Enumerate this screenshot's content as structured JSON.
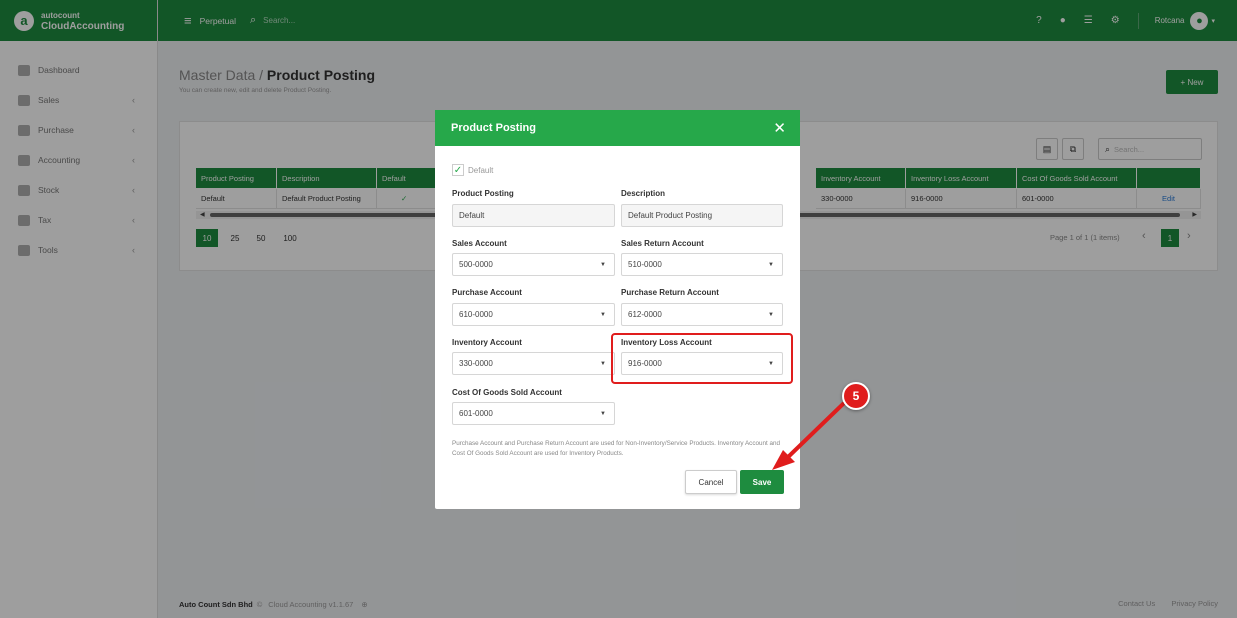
{
  "brand": {
    "logo_letter": "a",
    "top": "autocount",
    "bottom": "CloudAccounting"
  },
  "topbar": {
    "mode": "Perpetual",
    "search_placeholder": "Search...",
    "user": "Rotcana"
  },
  "sidebar": {
    "items": [
      {
        "label": "Dashboard",
        "icon": "dashboard-icon",
        "has_chevron": false
      },
      {
        "label": "Sales",
        "icon": "sales-icon",
        "has_chevron": true
      },
      {
        "label": "Purchase",
        "icon": "purchase-icon",
        "has_chevron": true
      },
      {
        "label": "Accounting",
        "icon": "accounting-icon",
        "has_chevron": true
      },
      {
        "label": "Stock",
        "icon": "stock-icon",
        "has_chevron": true
      },
      {
        "label": "Tax",
        "icon": "tax-icon",
        "has_chevron": true
      },
      {
        "label": "Tools",
        "icon": "tools-icon",
        "has_chevron": true
      }
    ]
  },
  "page": {
    "breadcrumb": "Master Data / ",
    "title": "Product Posting",
    "subtitle": "You can create new, edit and delete Product Posting.",
    "new_button": "+ New",
    "search_placeholder": "Search..."
  },
  "grid": {
    "headers": [
      "Product Posting",
      "Description",
      "Default",
      "Inventory Account",
      "Inventory Loss Account",
      "Cost Of Goods Sold Account"
    ],
    "row": {
      "product_posting": "Default",
      "description": "Default Product Posting",
      "default_checked": "✓",
      "inventory_account": "330-0000",
      "inventory_loss_account": "916-0000",
      "cogs_account": "601-0000",
      "edit": "Edit"
    }
  },
  "pager": {
    "sizes": [
      "10",
      "25",
      "50",
      "100"
    ],
    "info": "Page 1 of 1 (1 items)",
    "current": "1"
  },
  "footer": {
    "company": "Auto Count Sdn Bhd",
    "copyright": "©",
    "app": "Cloud Accounting v1.1.67",
    "contact": "Contact Us",
    "privacy": "Privacy Policy"
  },
  "modal": {
    "title": "Product Posting",
    "default_label": "Default",
    "fields": {
      "product_posting": {
        "label": "Product Posting",
        "value": "Default"
      },
      "description": {
        "label": "Description",
        "value": "Default Product Posting"
      },
      "sales_account": {
        "label": "Sales Account",
        "value": "500-0000"
      },
      "sales_return_account": {
        "label": "Sales Return Account",
        "value": "510-0000"
      },
      "purchase_account": {
        "label": "Purchase Account",
        "value": "610-0000"
      },
      "purchase_return_account": {
        "label": "Purchase Return Account",
        "value": "612-0000"
      },
      "inventory_account": {
        "label": "Inventory Account",
        "value": "330-0000"
      },
      "inventory_loss_account": {
        "label": "Inventory Loss Account",
        "value": "916-0000"
      },
      "cogs_account": {
        "label": "Cost Of Goods Sold Account",
        "value": "601-0000"
      }
    },
    "note": "Purchase Account and Purchase Return Account are used for Non-Inventory/Service Products. Inventory Account and Cost Of Goods Sold Account are used for Inventory Products.",
    "cancel": "Cancel",
    "save": "Save"
  },
  "annotation": {
    "step": "5",
    "color": "#e01d1d"
  },
  "colors": {
    "brand_green": "#1e8c3f",
    "modal_header": "#26a84a",
    "link": "#2b7bd6"
  }
}
